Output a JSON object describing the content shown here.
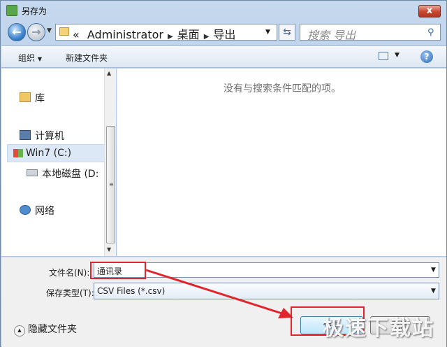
{
  "window": {
    "title": "另存为",
    "close_label": "x"
  },
  "address_bar": {
    "chevron": "«",
    "path": [
      "Administrator",
      "桌面",
      "导出"
    ]
  },
  "search": {
    "placeholder": "搜索 导出"
  },
  "toolbar": {
    "organize_label": "组织",
    "new_folder_label": "新建文件夹"
  },
  "nav": {
    "library": "库",
    "computer": "计算机",
    "drive_c": "Win7 (C:)",
    "drive_d": "本地磁盘 (D:",
    "network": "网络"
  },
  "content": {
    "empty_message": "没有与搜索条件匹配的项。"
  },
  "form": {
    "filename_label": "文件名(N):",
    "filename_value": "通讯录",
    "filetype_label": "保存类型(T):",
    "filetype_value": "CSV Files (*.csv)"
  },
  "footer": {
    "hide_folders_label": "隐藏文件夹",
    "save_label": "保存",
    "cancel_label": "取消"
  },
  "watermark": "极速下载站",
  "colors": {
    "annotation": "#e0262c",
    "accent": "#3c7fb1"
  }
}
